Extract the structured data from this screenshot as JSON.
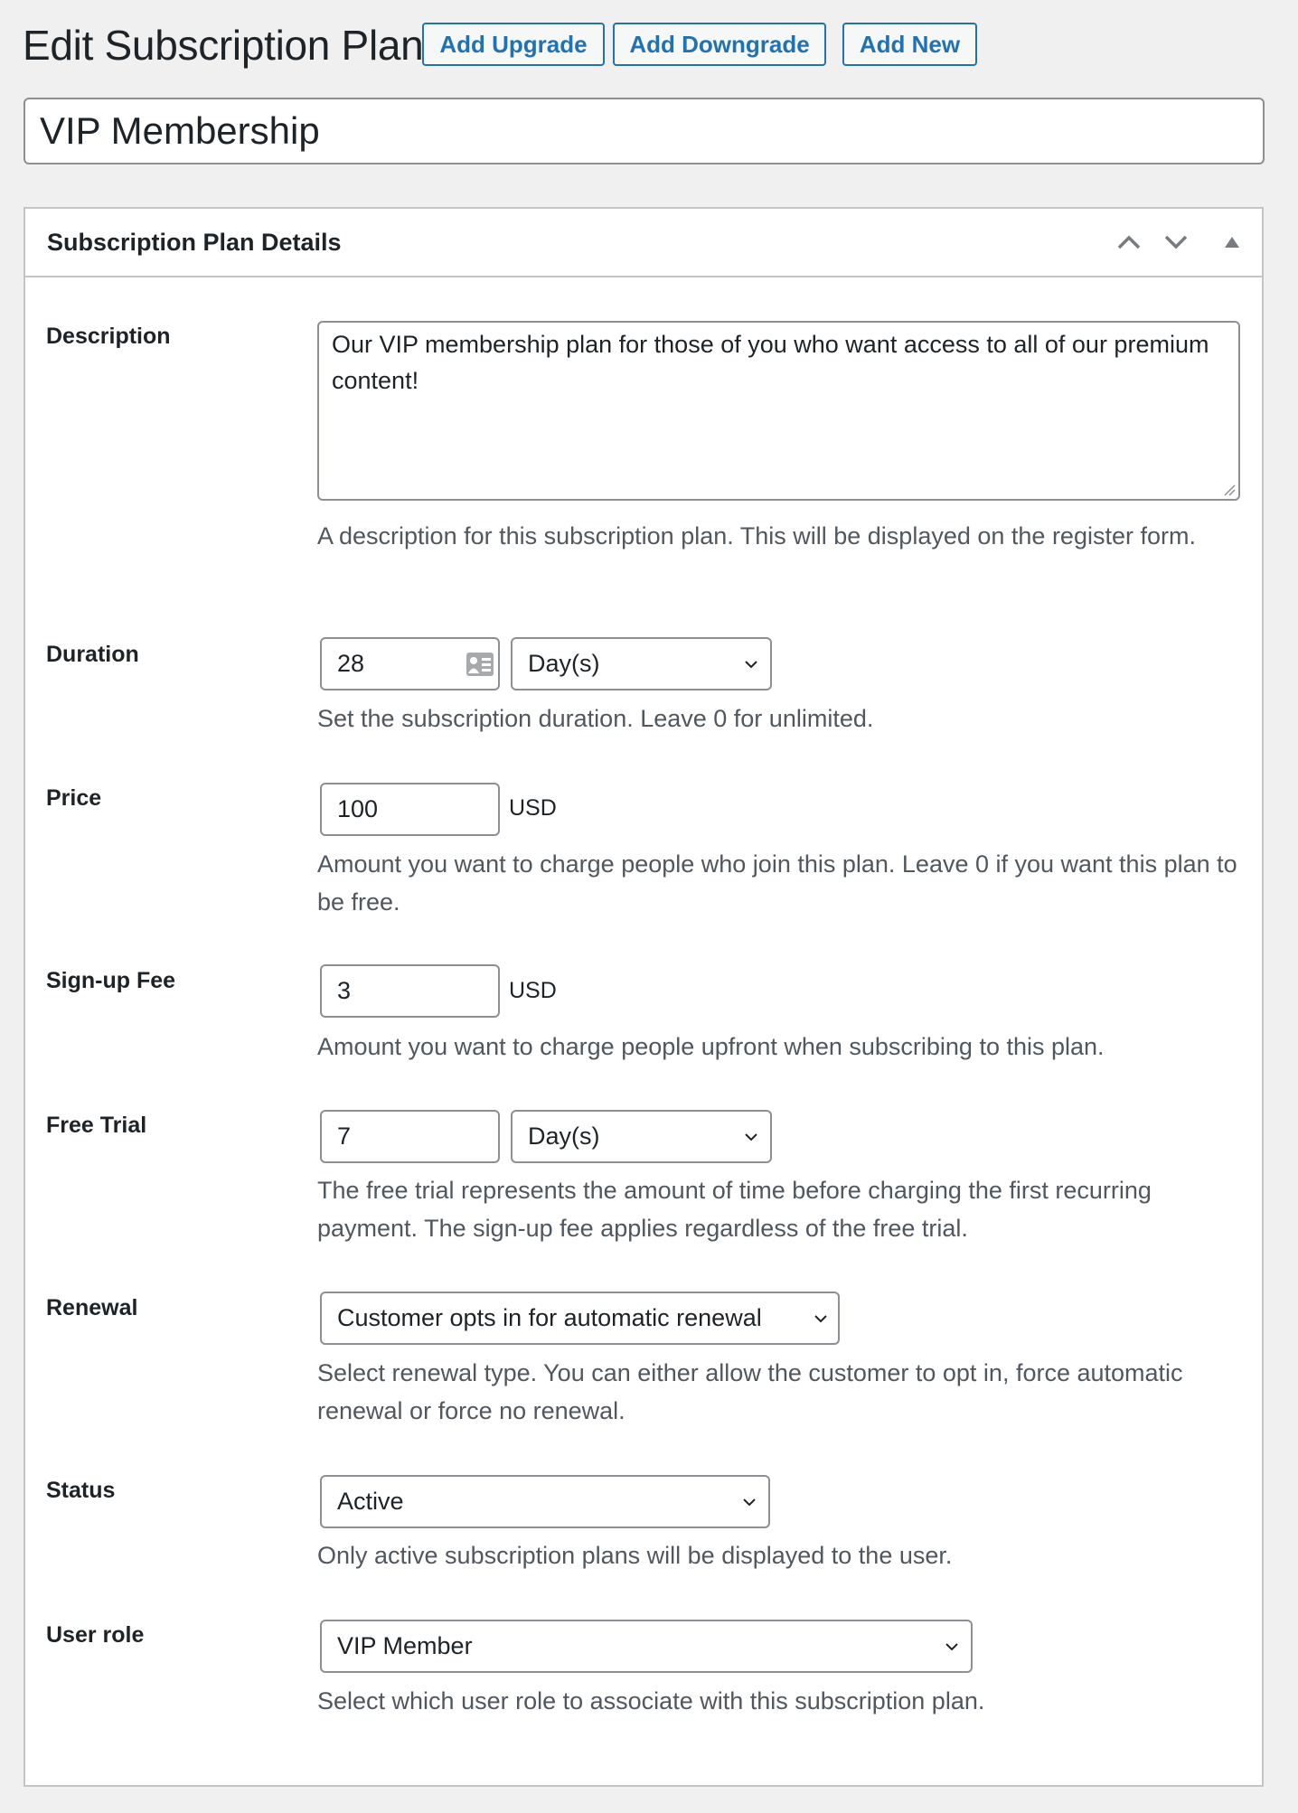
{
  "header": {
    "title": "Edit Subscription Plan",
    "buttons": [
      "Add Upgrade",
      "Add Downgrade",
      "Add New"
    ]
  },
  "plan_title": "VIP Membership",
  "postbox": {
    "title": "Subscription Plan Details",
    "icons": [
      "move-up",
      "move-down",
      "toggle-panel"
    ]
  },
  "fields": {
    "description": {
      "label": "Description",
      "value": "Our VIP membership plan for those of you who want access to all of our premium content!",
      "help": "A description for this subscription plan. This will be displayed on the register form."
    },
    "duration": {
      "label": "Duration",
      "value": "28",
      "unit": "Day(s)",
      "help": "Set the subscription duration. Leave 0 for unlimited."
    },
    "price": {
      "label": "Price",
      "value": "100",
      "currency": "USD",
      "help": "Amount you want to charge people who join this plan. Leave 0 if you want this plan to be free."
    },
    "signup_fee": {
      "label": "Sign-up Fee",
      "value": "3",
      "currency": "USD",
      "help": "Amount you want to charge people upfront when subscribing to this plan."
    },
    "free_trial": {
      "label": "Free Trial",
      "value": "7",
      "unit": "Day(s)",
      "help": "The free trial represents the amount of time before charging the first recurring payment. The sign-up fee applies regardless of the free trial."
    },
    "renewal": {
      "label": "Renewal",
      "value": "Customer opts in for automatic renewal",
      "help": "Select renewal type. You can either allow the customer to opt in, force automatic renewal or force no renewal."
    },
    "status": {
      "label": "Status",
      "value": "Active",
      "help": "Only active subscription plans will be displayed to the user."
    },
    "user_role": {
      "label": "User role",
      "value": "VIP Member",
      "help": "Select which user role to associate with this subscription plan."
    }
  },
  "colors": {
    "accent": "#2271b1",
    "background": "#f0f0f1",
    "help_text": "#50575e",
    "border": "#8c8f94"
  }
}
